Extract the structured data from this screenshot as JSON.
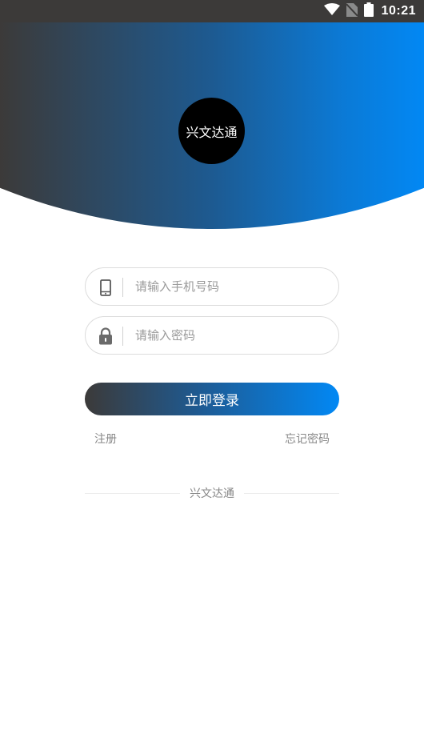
{
  "status_bar": {
    "time": "10:21",
    "icons": [
      "wifi-icon",
      "no-sim-icon",
      "battery-icon"
    ]
  },
  "logo": {
    "text": "兴文达通"
  },
  "form": {
    "phone": {
      "icon": "phone-icon",
      "placeholder": "请输入手机号码",
      "value": ""
    },
    "password": {
      "icon": "lock-icon",
      "placeholder": "请输入密码",
      "value": ""
    },
    "login_label": "立即登录",
    "register_label": "注册",
    "forgot_label": "忘记密码"
  },
  "footer": {
    "brand": "兴文达通"
  },
  "colors": {
    "dark": "#3c3a39",
    "accent": "#0288f4",
    "input_border": "#dcdcdc",
    "link_text": "#888888"
  }
}
